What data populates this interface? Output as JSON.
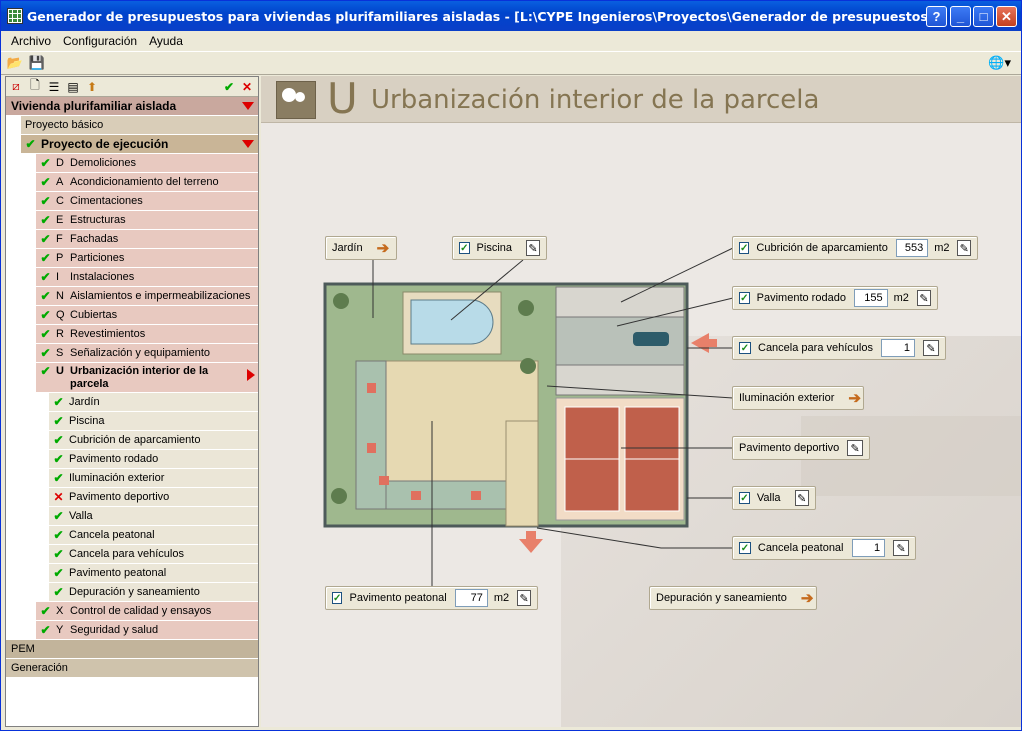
{
  "window": {
    "title": "Generador de presupuestos para viviendas plurifamiliares aisladas - [L:\\CYPE Ingenieros\\Proyectos\\Generador de presupuestos para viviendas plu"
  },
  "menu": [
    "Archivo",
    "Configuración",
    "Ayuda"
  ],
  "tree": {
    "root": "Vivienda plurifamiliar aislada",
    "basic": "Proyecto básico",
    "exec": "Proyecto de ejecución",
    "chapters": [
      {
        "code": "D",
        "label": "Demoliciones"
      },
      {
        "code": "A",
        "label": "Acondicionamiento del terreno"
      },
      {
        "code": "C",
        "label": "Cimentaciones"
      },
      {
        "code": "E",
        "label": "Estructuras"
      },
      {
        "code": "F",
        "label": "Fachadas"
      },
      {
        "code": "P",
        "label": "Particiones"
      },
      {
        "code": "I",
        "label": "Instalaciones"
      },
      {
        "code": "N",
        "label": "Aislamientos e impermeabilizaciones"
      },
      {
        "code": "Q",
        "label": "Cubiertas"
      },
      {
        "code": "R",
        "label": "Revestimientos"
      },
      {
        "code": "S",
        "label": "Señalización y equipamiento"
      }
    ],
    "current": {
      "code": "U",
      "label": "Urbanización interior de la parcela"
    },
    "subitems": [
      {
        "label": "Jardín",
        "status": "ok"
      },
      {
        "label": "Piscina",
        "status": "ok"
      },
      {
        "label": "Cubrición de aparcamiento",
        "status": "ok"
      },
      {
        "label": "Pavimento rodado",
        "status": "ok"
      },
      {
        "label": "Iluminación exterior",
        "status": "ok"
      },
      {
        "label": "Pavimento deportivo",
        "status": "x"
      },
      {
        "label": "Valla",
        "status": "ok"
      },
      {
        "label": "Cancela peatonal",
        "status": "ok"
      },
      {
        "label": "Cancela para vehículos",
        "status": "ok"
      },
      {
        "label": "Pavimento peatonal",
        "status": "ok"
      },
      {
        "label": "Depuración y saneamiento",
        "status": "ok"
      }
    ],
    "after": [
      {
        "code": "X",
        "label": "Control de calidad y ensayos"
      },
      {
        "code": "Y",
        "label": "Seguridad y salud"
      }
    ],
    "pem": "PEM",
    "gen": "Generación"
  },
  "header": {
    "letter": "U",
    "title": "Urbanización interior de la parcela"
  },
  "labels": {
    "jardin": "Jardín",
    "piscina": "Piscina",
    "cubricion": "Cubrición de aparcamiento",
    "cubricion_val": "553",
    "pav_rodado": "Pavimento rodado",
    "pav_rodado_val": "155",
    "cancela_veh": "Cancela para vehículos",
    "cancela_veh_val": "1",
    "iluminacion": "Iluminación exterior",
    "pav_deportivo": "Pavimento deportivo",
    "valla": "Valla",
    "cancela_peat": "Cancela peatonal",
    "cancela_peat_val": "1",
    "pav_peatonal": "Pavimento peatonal",
    "pav_peatonal_val": "77",
    "depuracion": "Depuración y saneamiento",
    "unit_m2": "m2"
  }
}
